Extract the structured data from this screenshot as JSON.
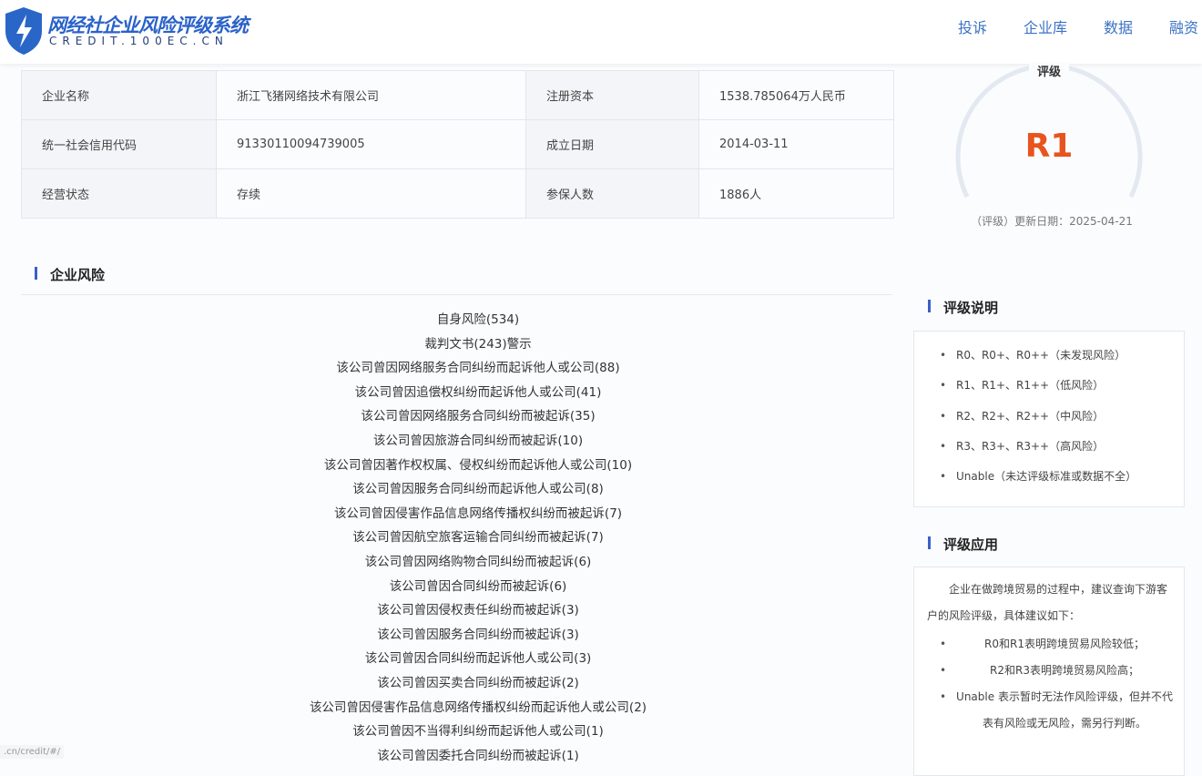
{
  "header": {
    "logo_title": "网经社企业风险评级系统",
    "logo_sub": "CREDIT.100EC.CN",
    "nav": [
      "投诉",
      "企业库",
      "数据",
      "融资"
    ]
  },
  "info": {
    "rows": [
      {
        "label1": "企业名称",
        "value1": "浙江飞猪网络技术有限公司",
        "label2": "注册资本",
        "value2": "1538.785064万人民币"
      },
      {
        "label1": "统一社会信用代码",
        "value1": "91330110094739005",
        "label2": "成立日期",
        "value2": "2014-03-11"
      },
      {
        "label1": "经营状态",
        "value1": "存续",
        "label2": "参保人数",
        "value2": "1886人"
      }
    ]
  },
  "risk": {
    "title": "企业风险",
    "items": [
      "自身风险(534)",
      "裁判文书(243)警示",
      "该公司曾因网络服务合同纠纷而起诉他人或公司(88)",
      "该公司曾因追偿权纠纷而起诉他人或公司(41)",
      "该公司曾因网络服务合同纠纷而被起诉(35)",
      "该公司曾因旅游合同纠纷而被起诉(10)",
      "该公司曾因著作权权属、侵权纠纷而起诉他人或公司(10)",
      "该公司曾因服务合同纠纷而起诉他人或公司(8)",
      "该公司曾因侵害作品信息网络传播权纠纷而被起诉(7)",
      "该公司曾因航空旅客运输合同纠纷而被起诉(7)",
      "该公司曾因网络购物合同纠纷而被起诉(6)",
      "该公司曾因合同纠纷而被起诉(6)",
      "该公司曾因侵权责任纠纷而被起诉(3)",
      "该公司曾因服务合同纠纷而被起诉(3)",
      "该公司曾因合同纠纷而起诉他人或公司(3)",
      "该公司曾因买卖合同纠纷而被起诉(2)",
      "该公司曾因侵害作品信息网络传播权纠纷而起诉他人或公司(2)",
      "该公司曾因不当得利纠纷而起诉他人或公司(1)",
      "该公司曾因委托合同纠纷而被起诉(1)"
    ]
  },
  "rating": {
    "label": "评级",
    "grade": "R1",
    "grade_color": "#e8541e",
    "date": "（评级）更新日期：2025-04-21"
  },
  "explain": {
    "title": "评级说明",
    "items": [
      "R0、R0+、R0++（未发现风险）",
      "R1、R1+、R1++（低风险）",
      "R2、R2+、R2++（中风险）",
      "R3、R3+、R3++（高风险）",
      "Unable（未达评级标准或数据不全）"
    ]
  },
  "application": {
    "title": "评级应用",
    "intro": "企业在做跨境贸易的过程中，建议查询下游客户的风险评级，具体建议如下：",
    "items": [
      "R0和R1表明跨境贸易风险较低；",
      "R2和R3表明跨境贸易风险高；",
      "Unable 表示暂时无法作风险评级，但并不代表有风险或无风险，需另行判断。"
    ]
  },
  "status_url": ".cn/credit/#/"
}
